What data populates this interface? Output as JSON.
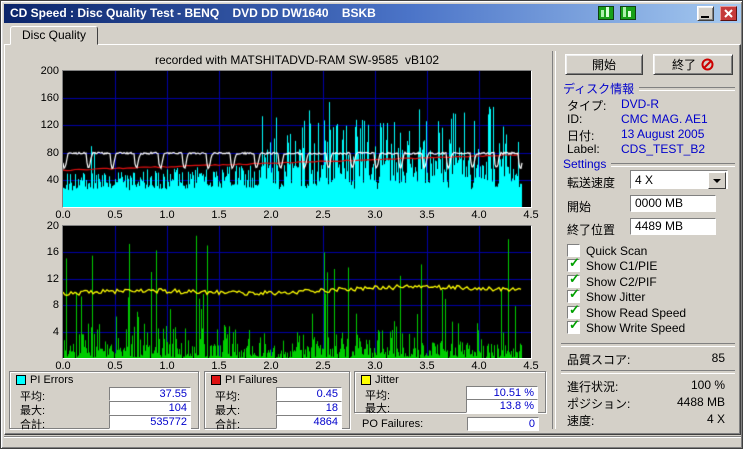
{
  "colors": {
    "titlebar_start": "#0a246a",
    "titlebar_end": "#a6caf0",
    "window_face": "#d4d0c8",
    "chart_bg": "#000000",
    "grid": "#0000a8",
    "cyan": "#00ffff",
    "red": "#e01010",
    "white": "#ffffff",
    "green": "#00cc00",
    "yellow": "#ffff00",
    "value_blue": "#0000cc",
    "check_green": "#00a000"
  },
  "window": {
    "title": "CD Speed : Disc Quality Test - BENQ    DVD DD DW1640    BSKB"
  },
  "tabs": {
    "disc_quality": "Disc Quality"
  },
  "chart_note": "recorded with MATSHITADVD-RAM SW-9585  vB102",
  "buttons": {
    "start": "開始",
    "stop": "終了"
  },
  "disc_info": {
    "header": "ディスク情報",
    "rows": [
      {
        "label": "タイプ:",
        "value": "DVD-R"
      },
      {
        "label": "ID:",
        "value": "CMC MAG. AE1"
      },
      {
        "label": "日付:",
        "value": "13 August 2005"
      },
      {
        "label": "Label:",
        "value": "CDS_TEST_B2"
      }
    ]
  },
  "settings": {
    "header": "Settings",
    "speed_label": "転送速度",
    "speed_value": "4 X",
    "start_label": "開始",
    "start_value": "0000 MB",
    "end_label": "終了位置",
    "end_value": "4489 MB",
    "checkboxes": [
      {
        "label": "Quick Scan",
        "checked": false
      },
      {
        "label": "Show C1/PIE",
        "checked": true
      },
      {
        "label": "Show C2/PIF",
        "checked": true
      },
      {
        "label": "Show Jitter",
        "checked": true
      },
      {
        "label": "Show Read Speed",
        "checked": true
      },
      {
        "label": "Show Write Speed",
        "checked": true
      }
    ]
  },
  "status": {
    "score_label": "品質スコア:",
    "score_value": "85",
    "progress_label": "進行状況:",
    "progress_value": "100 %",
    "position_label": "ポジション:",
    "position_value": "4488 MB",
    "speed_label": "速度:",
    "speed_value": "4 X"
  },
  "stats": {
    "pi_errors": {
      "title": "PI Errors",
      "rows": [
        [
          "平均:",
          "37.55"
        ],
        [
          "最大:",
          "104"
        ],
        [
          "合計:",
          "535772"
        ]
      ]
    },
    "pi_failures": {
      "title": "PI Failures",
      "rows": [
        [
          "平均:",
          "0.45"
        ],
        [
          "最大:",
          "18"
        ],
        [
          "合計:",
          "4864"
        ]
      ]
    },
    "jitter": {
      "title": "Jitter",
      "rows": [
        [
          "平均:",
          "10.51 %"
        ],
        [
          "最大:",
          "13.8 %"
        ]
      ],
      "po_label": "PO Failures:",
      "po_value": "0"
    }
  },
  "chart_data": [
    {
      "type": "area",
      "title": "PI Errors / read & write speed vs disc position (GB)",
      "x_ticks": [
        "0.0",
        "0.5",
        "1.0",
        "1.5",
        "2.0",
        "2.5",
        "3.0",
        "3.5",
        "4.0",
        "4.5"
      ],
      "y_ticks": [
        "200",
        "160",
        "120",
        "80",
        "40"
      ],
      "x_range": [
        0,
        4.5
      ],
      "y_range": [
        0,
        200
      ],
      "data_end_x": 4.42,
      "grid": true,
      "series": [
        {
          "name": "PI Errors (C1/PIE)",
          "style": "cyan-filled-spikes",
          "avg": 37.55,
          "max": 104,
          "total": 535772
        },
        {
          "name": "Write Speed",
          "style": "red-line",
          "start_value": 54,
          "end_value": 77
        },
        {
          "name": "Read Speed",
          "style": "white-line",
          "level": 79,
          "periodic_dips_to": 58
        }
      ]
    },
    {
      "type": "bar",
      "title": "PI Failures / Jitter vs disc position (GB)",
      "x_ticks": [
        "0.0",
        "0.5",
        "1.0",
        "1.5",
        "2.0",
        "2.5",
        "3.0",
        "3.5",
        "4.0",
        "4.5"
      ],
      "y_ticks": [
        "20",
        "16",
        "12",
        "8",
        "4"
      ],
      "x_range": [
        0,
        4.5
      ],
      "y_range": [
        0,
        20
      ],
      "data_end_x": 4.42,
      "grid": true,
      "series": [
        {
          "name": "PI Failures (C2/PIF)",
          "style": "green-spikes",
          "avg": 0.45,
          "max": 18,
          "total": 4864
        },
        {
          "name": "Jitter",
          "style": "yellow-line",
          "avg": 10.51,
          "max": 13.8
        }
      ]
    }
  ]
}
